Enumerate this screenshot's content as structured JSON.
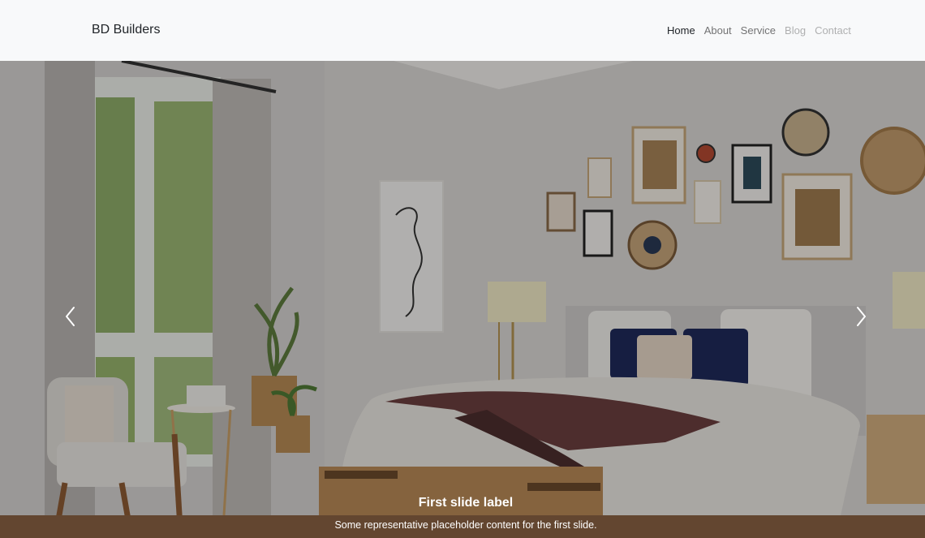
{
  "navbar": {
    "brand": "BD Builders",
    "links": [
      {
        "label": "Home",
        "state": "active"
      },
      {
        "label": "About",
        "state": "normal"
      },
      {
        "label": "Service",
        "state": "normal"
      },
      {
        "label": "Blog",
        "state": "disabled"
      },
      {
        "label": "Contact",
        "state": "disabled"
      }
    ]
  },
  "carousel": {
    "slide_title": "First slide label",
    "slide_text": "Some representative placeholder content for the first slide.",
    "prev_icon": "chevron-left-icon",
    "next_icon": "chevron-right-icon"
  },
  "colors": {
    "nav_bg": "#f8f9fa",
    "text_active": "#212529",
    "caption_text": "#ffffff"
  }
}
